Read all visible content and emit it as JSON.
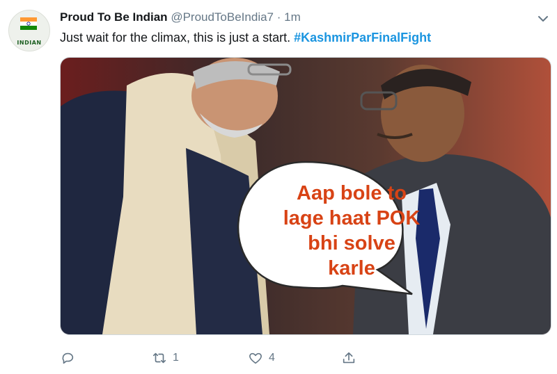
{
  "tweet": {
    "avatar_label": "INDIAN",
    "display_name": "Proud To Be Indian",
    "handle": "@ProudToBeIndia7",
    "separator": "·",
    "timestamp": "1m",
    "text": "Just wait for the climax, this is just a start.",
    "hashtag": "#KashmirParFinalFight",
    "image_caption_lines": [
      "Aap bole to",
      "lage haat POK",
      "bhi solve",
      "karle"
    ]
  },
  "actions": {
    "reply_count": "",
    "retweet_count": "1",
    "like_count": "4",
    "share_count": ""
  },
  "icons": [
    "chevron-down-icon",
    "reply-icon",
    "retweet-icon",
    "like-icon",
    "share-icon"
  ],
  "colors": {
    "text": "#14171a",
    "muted": "#657786",
    "hashtag": "#1b95e0",
    "caption": "#d84315"
  }
}
